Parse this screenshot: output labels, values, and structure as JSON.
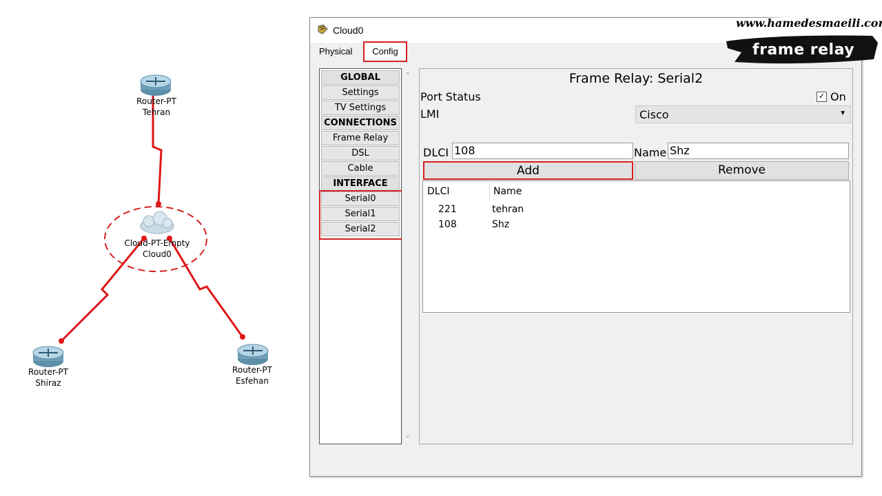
{
  "watermark": {
    "url": "www.hamedesmaeili.com",
    "title": "frame relay"
  },
  "topology": {
    "routers": [
      {
        "type": "Router-PT",
        "name": "Tehran"
      },
      {
        "type": "Router-PT",
        "name": "Shiraz"
      },
      {
        "type": "Router-PT",
        "name": "Esfehan"
      }
    ],
    "cloud": {
      "type": "Cloud-PT-Empty",
      "name": "Cloud0"
    }
  },
  "window": {
    "title": "Cloud0",
    "tabs": [
      "Physical",
      "Config"
    ],
    "active_tab": "Config"
  },
  "sidebar": {
    "items": [
      {
        "label": "GLOBAL",
        "header": true
      },
      {
        "label": "Settings"
      },
      {
        "label": "TV Settings"
      },
      {
        "label": "CONNECTIONS",
        "header": true
      },
      {
        "label": "Frame Relay"
      },
      {
        "label": "DSL"
      },
      {
        "label": "Cable"
      },
      {
        "label": "INTERFACE",
        "header": true
      },
      {
        "label": "Serial0"
      },
      {
        "label": "Serial1"
      },
      {
        "label": "Serial2"
      }
    ]
  },
  "panel": {
    "title": "Frame Relay: Serial2",
    "port_status_label": "Port Status",
    "port_status_checked": true,
    "port_status_value": "On",
    "lmi_label": "LMI",
    "lmi_value": "Cisco",
    "dlci_label": "DLCI",
    "dlci_value": "108",
    "name_label": "Name",
    "name_value": "Shz",
    "add_label": "Add",
    "remove_label": "Remove",
    "table": {
      "headers": [
        "DLCI",
        "Name"
      ],
      "rows": [
        {
          "dlci": "221",
          "name": "tehran"
        },
        {
          "dlci": "108",
          "name": "Shz"
        }
      ]
    }
  },
  "colors": {
    "link": "#e01616",
    "highlight": "#d51f1f"
  }
}
